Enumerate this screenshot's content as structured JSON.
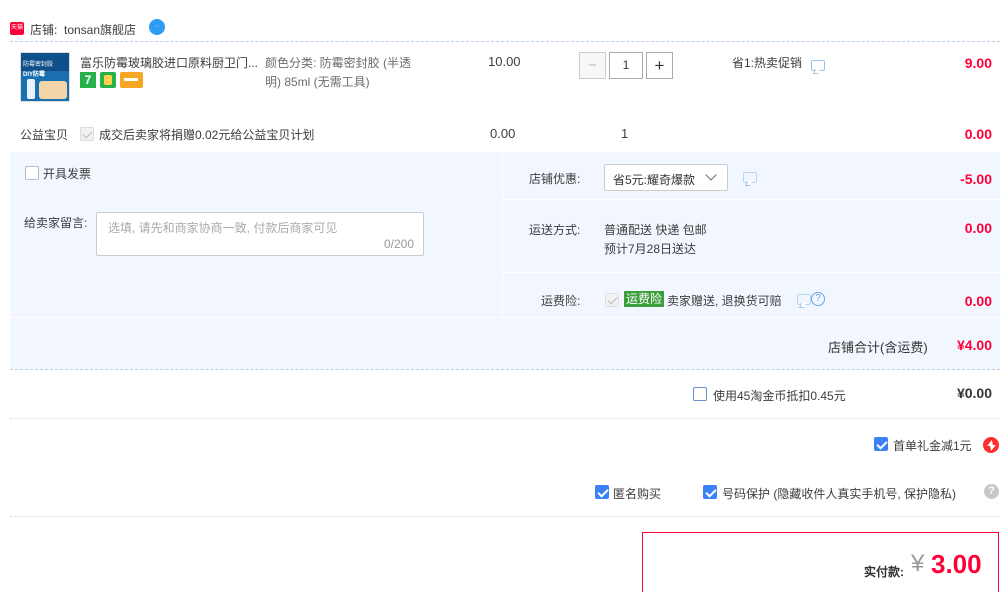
{
  "shop": {
    "badge": "天猫",
    "label": "店铺:",
    "name": "tonsan旗舰店",
    "wangwang": "··"
  },
  "item": {
    "title": "富乐防霉玻璃胶进口原料厨卫门...",
    "thumb_text_1": "防霉密封胶",
    "thumb_text_2": "DIY防霉",
    "tag_7": "7",
    "sku_line1": "颜色分类: 防霉密封胶 (半透",
    "sku_line2": "明) 85ml (无需工具)",
    "price": "10.00",
    "qty": "1",
    "qty_minus": "−",
    "qty_plus": "+",
    "promo": "省1:热卖促销",
    "total": "9.00"
  },
  "charity": {
    "label": "公益宝贝",
    "text": "成交后卖家将捐赠0.02元给公益宝贝计划",
    "price": "0.00",
    "qty": "1",
    "total": "0.00"
  },
  "invoice": {
    "label": "开具发票"
  },
  "message": {
    "label": "给卖家留言:",
    "placeholder": "选填, 请先和商家协商一致, 付款后商家可见",
    "counter": "0/200"
  },
  "discount": {
    "label": "店铺优惠:",
    "selected": "省5元:耀奇爆款",
    "amount": "-5.00"
  },
  "shipping": {
    "label": "运送方式:",
    "method": "普通配送 快递 包邮",
    "eta": "预计7月28日送达",
    "amount": "0.00"
  },
  "insurance": {
    "label": "运费险:",
    "tag": "运费险",
    "text": "卖家赠送, 退换货可赔",
    "amount": "0.00",
    "help": "?"
  },
  "shop_total": {
    "label": "店铺合计(含运费)",
    "amount": "¥4.00"
  },
  "coins": {
    "label": "使用45淘金币抵扣0.45元",
    "amount": "¥0.00"
  },
  "first_gift": {
    "label": "首单礼金减1元"
  },
  "anonymous": {
    "label": "匿名购买"
  },
  "privacy": {
    "label": "号码保护 (隐藏收件人真实手机号, 保护隐私)",
    "help": "?"
  },
  "pay": {
    "label": "实付款:",
    "currency": "¥",
    "amount": "3.00"
  },
  "colors": {
    "accent_red": "#ff0036",
    "light_blue_bg": "#f2f7ff",
    "checkbox_blue": "#3b82f6",
    "insurance_green": "#3d9e3d"
  }
}
